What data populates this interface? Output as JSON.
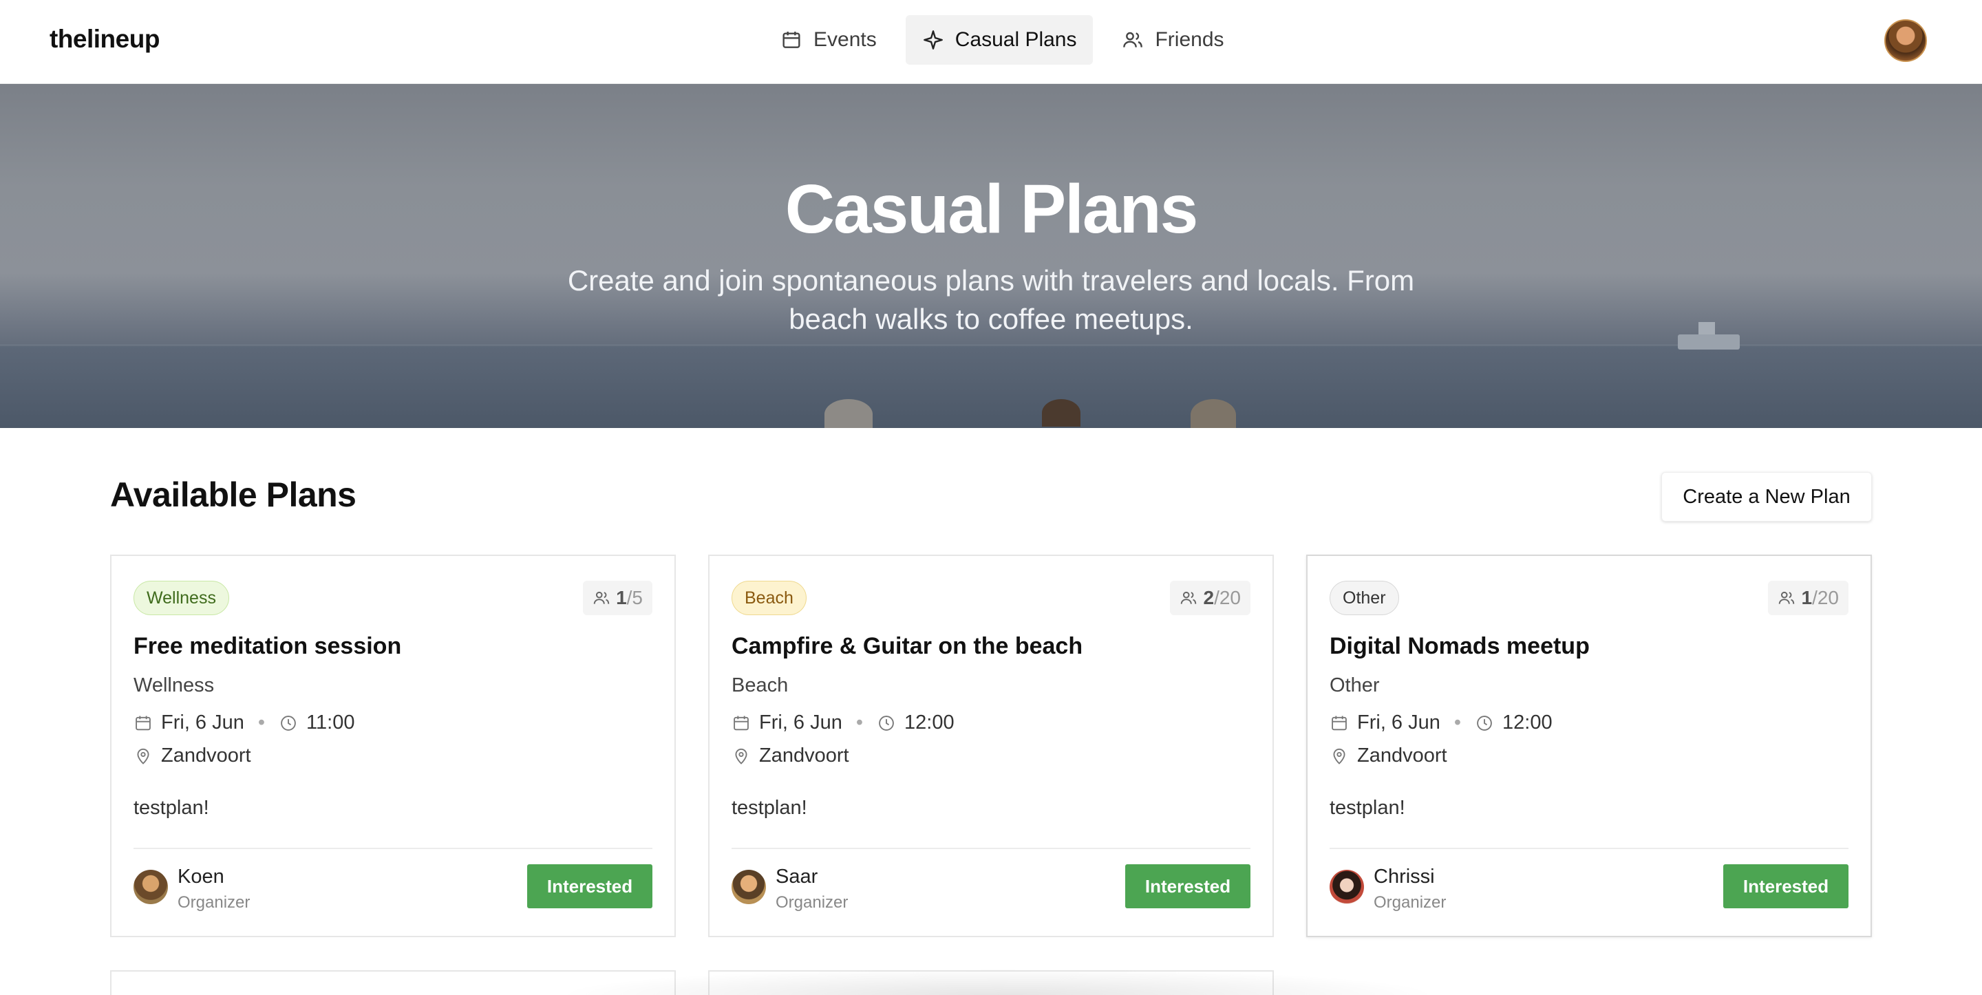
{
  "nav": {
    "logo": "thelineup",
    "tabs": [
      {
        "label": "Events",
        "icon": "calendar-icon",
        "active": false
      },
      {
        "label": "Casual Plans",
        "icon": "sparkle-icon",
        "active": true
      },
      {
        "label": "Friends",
        "icon": "users-icon",
        "active": false
      }
    ],
    "avatar": "user-avatar"
  },
  "hero": {
    "title": "Casual Plans",
    "subtitle": "Create and join spontaneous plans with travelers and locals. From beach walks to coffee meetups."
  },
  "section": {
    "title": "Available Plans",
    "create_button": "Create a New Plan"
  },
  "plans": [
    {
      "badge": "Wellness",
      "badge_style": "wellness",
      "count_current": "1",
      "count_total": "/5",
      "title": "Free meditation session",
      "category": "Wellness",
      "date": "Fri, 6 Jun",
      "time": "11:00",
      "location": "Zandvoort",
      "description": "testplan!",
      "organizer": "Koen",
      "organizer_role": "Organizer",
      "button": "Interested"
    },
    {
      "badge": "Beach",
      "badge_style": "beach",
      "count_current": "2",
      "count_total": "/20",
      "title": "Campfire & Guitar on the beach",
      "category": "Beach",
      "date": "Fri, 6 Jun",
      "time": "12:00",
      "location": "Zandvoort",
      "description": "testplan!",
      "organizer": "Saar",
      "organizer_role": "Organizer",
      "button": "Interested"
    },
    {
      "badge": "Other",
      "badge_style": "other",
      "count_current": "1",
      "count_total": "/20",
      "title": "Digital Nomads meetup",
      "category": "Other",
      "date": "Fri, 6 Jun",
      "time": "12:00",
      "location": "Zandvoort",
      "description": "testplan!",
      "organizer": "Chrissi",
      "organizer_role": "Organizer",
      "button": "Interested"
    }
  ],
  "colors": {
    "accent_green": "#4ca552",
    "wellness_bg": "#edf8de",
    "beach_bg": "#fdf3cf",
    "other_bg": "#f4f4f4"
  }
}
